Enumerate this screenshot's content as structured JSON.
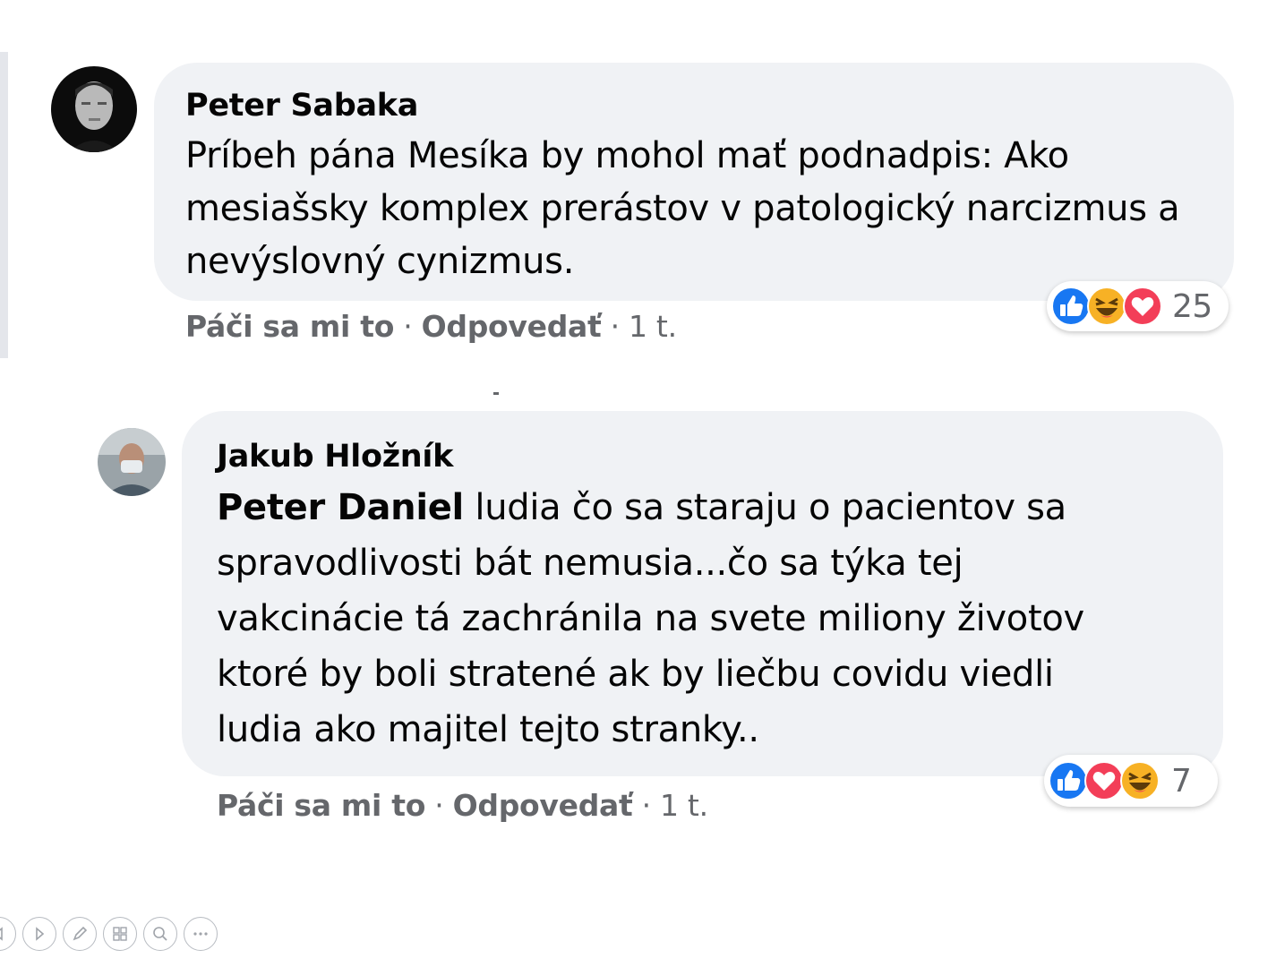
{
  "comments": [
    {
      "author": "Peter Sabaka",
      "text_lines": [
        "Príbeh pána Mesíka by mohol mať podnadpis: Ako",
        "mesiašsky komplex prerástov v patologický narcizmus a",
        "nevýslovný cynizmus."
      ],
      "actions": {
        "like": "Páči sa mi to",
        "reply": "Odpovedať",
        "time": "1 t."
      },
      "reactions": {
        "icons": [
          "like-icon",
          "haha-icon",
          "love-icon"
        ],
        "count": "25"
      }
    },
    {
      "author": "Jakub Hložník",
      "mention": "Peter Daniel",
      "text_lines": [
        " ludia čo sa staraju o pacientov sa",
        "spravodlivosti bát nemusia...čo sa týka tej",
        "vakcinácie tá zachránila na svete miliony životov",
        "ktoré by boli stratené ak by liečbu covidu viedli",
        "ludia ako majitel tejto stranky.."
      ],
      "actions": {
        "like": "Páči sa mi to",
        "reply": "Odpovedať",
        "time": "1 t."
      },
      "reactions": {
        "icons": [
          "like-icon",
          "love-icon",
          "haha-icon"
        ],
        "count": "7"
      }
    }
  ],
  "separator": " · ",
  "colors": {
    "bubble": "#f0f2f5",
    "secondary_text": "#65676b",
    "like_blue": "#1877f2",
    "love_red": "#f33e58",
    "haha_yellow": "#f7b125"
  },
  "toolbar_icons": [
    "previous-icon",
    "next-icon",
    "pen-icon",
    "slides-icon",
    "zoom-icon",
    "more-icon"
  ]
}
